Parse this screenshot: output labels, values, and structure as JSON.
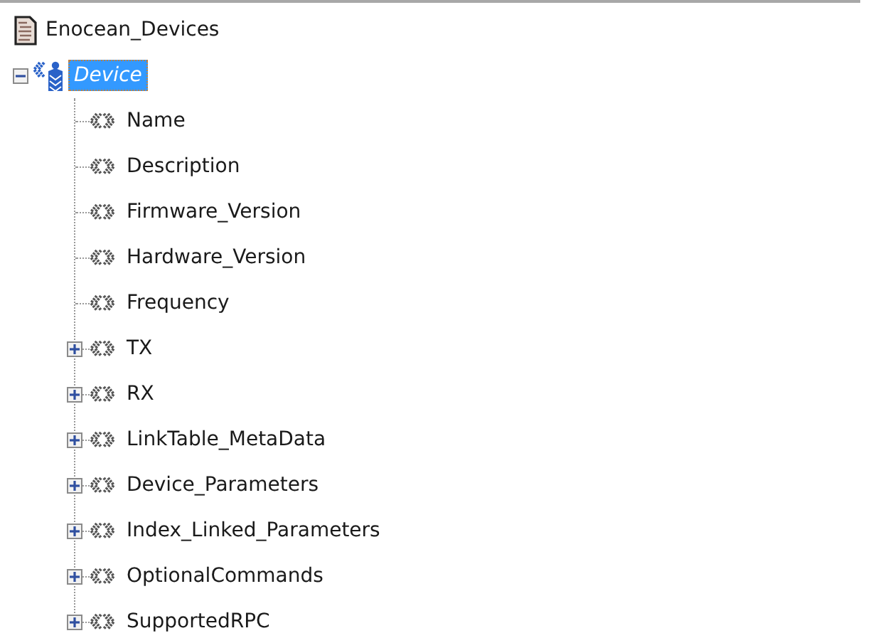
{
  "tree": {
    "label": "Enocean_Devices",
    "children": [
      {
        "label": "Device",
        "selected": true,
        "expanded": true,
        "children": [
          {
            "label": "Name",
            "selected": false,
            "kind": "leaf"
          },
          {
            "label": "Description",
            "selected": false,
            "kind": "leaf"
          },
          {
            "label": "Firmware_Version",
            "selected": false,
            "kind": "leaf"
          },
          {
            "label": "Hardware_Version",
            "selected": false,
            "kind": "leaf"
          },
          {
            "label": "Frequency",
            "selected": false,
            "kind": "leaf"
          },
          {
            "label": "TX",
            "selected": false,
            "kind": "group",
            "expanded": false
          },
          {
            "label": "RX",
            "selected": false,
            "kind": "group",
            "expanded": false
          },
          {
            "label": "LinkTable_MetaData",
            "selected": false,
            "kind": "group",
            "expanded": false
          },
          {
            "label": "Device_Parameters",
            "selected": false,
            "kind": "group",
            "expanded": false
          },
          {
            "label": "Index_Linked_Parameters",
            "selected": false,
            "kind": "group",
            "expanded": false
          },
          {
            "label": "OptionalCommands",
            "selected": false,
            "kind": "group",
            "expanded": false
          },
          {
            "label": "SupportedRPC",
            "selected": false,
            "kind": "group",
            "expanded": false
          }
        ]
      }
    ]
  }
}
